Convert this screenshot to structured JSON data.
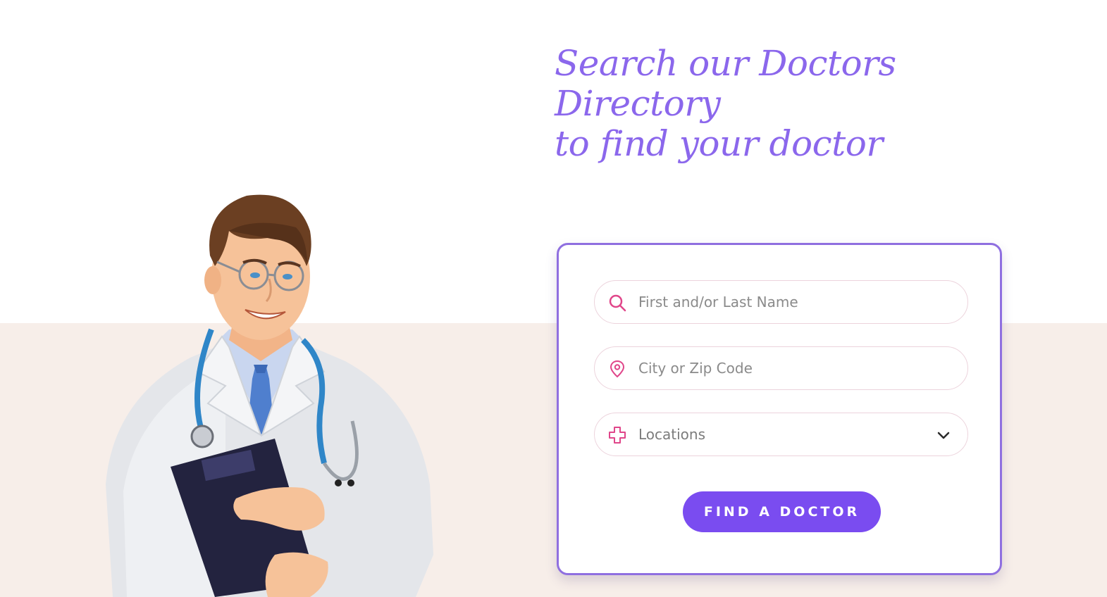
{
  "heading": {
    "line1": "Search our Doctors",
    "line2": "Directory",
    "line3": "to find your doctor"
  },
  "search_form": {
    "name_field": {
      "placeholder": "First and/or Last Name",
      "icon": "search-icon"
    },
    "location_field": {
      "placeholder": "City or Zip Code",
      "icon": "map-pin-icon"
    },
    "locations_select": {
      "selected": "Locations",
      "icon": "medical-cross-icon",
      "arrow": "chevron-down-icon"
    },
    "submit_label": "FIND A DOCTOR"
  },
  "colors": {
    "accent": "#7a4cf0",
    "heading": "#8b67ec",
    "icon": "#e0468a",
    "band": "#f7eee9"
  },
  "illustration": "doctor-illustration"
}
